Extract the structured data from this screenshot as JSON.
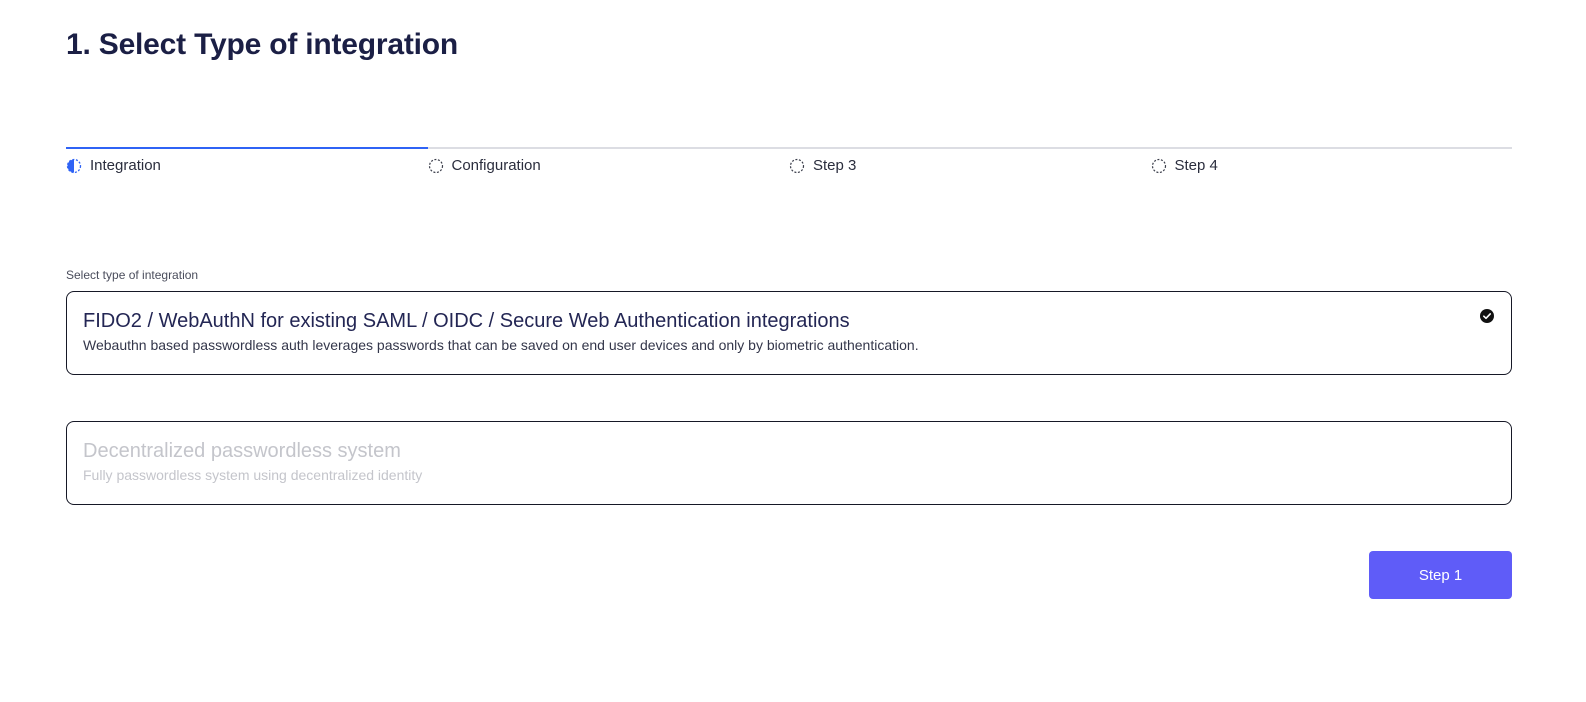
{
  "page": {
    "title": "1. Select Type of integration"
  },
  "stepper": {
    "steps": [
      {
        "label": "Integration",
        "state": "active",
        "icon": "half-circle-progress-icon"
      },
      {
        "label": "Configuration",
        "state": "pending",
        "icon": "dashed-circle-icon"
      },
      {
        "label": "Step 3",
        "state": "pending",
        "icon": "dashed-circle-icon"
      },
      {
        "label": "Step 4",
        "state": "pending",
        "icon": "dashed-circle-icon"
      }
    ]
  },
  "integration": {
    "field_label": "Select type of integration",
    "options": [
      {
        "title": "FIDO2 / WebAuthN for existing SAML / OIDC / Secure Web Authentication integrations",
        "description": "Webauthn based passwordless auth leverages passwords that can be saved on end user devices and only by biometric authentication.",
        "selected": true,
        "disabled": false,
        "icon": "check-circle-icon"
      },
      {
        "title": "Decentralized passwordless system",
        "description": "Fully passwordless system using decentralized identity",
        "selected": false,
        "disabled": true
      }
    ]
  },
  "actions": {
    "next_label": "Step 1"
  },
  "colors": {
    "accent": "#2f63f5",
    "button": "#5f5cf8",
    "title": "#1b1f45",
    "disabled_text": "#c4c5cb"
  }
}
